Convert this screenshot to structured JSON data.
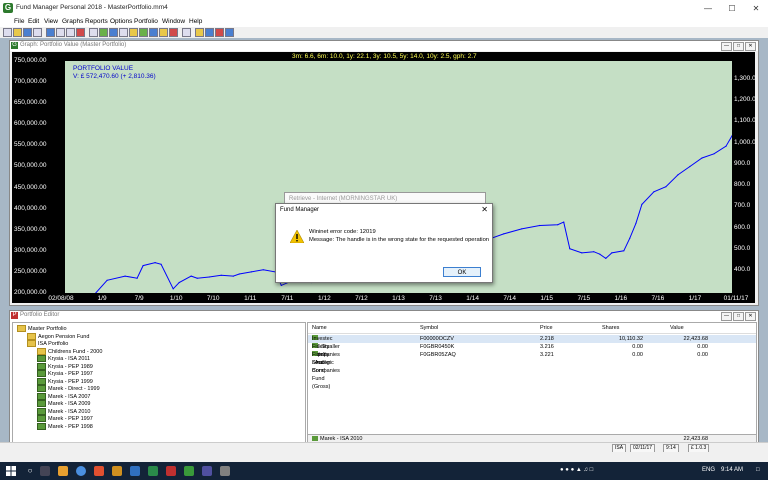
{
  "window": {
    "title": "Fund Manager Personal 2018 - MasterPortfolio.mm4",
    "app_icon_letter": "G"
  },
  "menu": [
    "File",
    "Edit",
    "View",
    "Graphs",
    "Reports",
    "Options",
    "Portfolio",
    "Window",
    "Help"
  ],
  "graph_window": {
    "title": "Graph: Portfolio Value (Master Portfolio)",
    "icon_letter": "G",
    "performance": "3m: 6.6,    6m: 10.0,    1y: 22.1,    3y: 10.5,    5y: 14.0,    10y: 2.5,    gph: 2.7",
    "label": "PORTFOLIO VALUE",
    "value": "V: £ 572,470.60 (+ 2,810.36)"
  },
  "chart_data": {
    "type": "line",
    "title": "Graph: Portfolio Value (Master Portfolio)",
    "xlabel": "",
    "ylabel": "",
    "ylim": [
      200000,
      750000
    ],
    "y_ticks": [
      "750,000.00",
      "700,000.00",
      "650,000.00",
      "600,000.00",
      "550,000.00",
      "500,000.00",
      "450,000.00",
      "400,000.00",
      "350,000.00",
      "300,000.00",
      "250,000.00",
      "200,000.00"
    ],
    "y2_ticks": [
      "1,300.0",
      "1,200.0",
      "1,100.0",
      "1,000.0",
      "900.0",
      "800.0",
      "700.0",
      "600.0",
      "500.0",
      "400.0"
    ],
    "x_ticks": [
      "02/08/08",
      "1/9",
      "7/9",
      "1/10",
      "7/10",
      "1/11",
      "7/11",
      "1/12",
      "7/12",
      "1/13",
      "7/13",
      "1/14",
      "7/14",
      "1/15",
      "7/15",
      "1/16",
      "7/16",
      "1/17",
      "01/11/17"
    ],
    "grid": false,
    "line_color": "#0000ff",
    "background": "#c5dfc5",
    "x": [
      "2008-08",
      "2008-12",
      "2009-01",
      "2009-03",
      "2009-06",
      "2009-08",
      "2009-09",
      "2009-11",
      "2009-12",
      "2010-02",
      "2010-03",
      "2010-05",
      "2010-06",
      "2010-08",
      "2010-10",
      "2010-12",
      "2011-01",
      "2011-03",
      "2011-05",
      "2011-07",
      "2011-08",
      "2011-10",
      "2011-12",
      "2012-01",
      "2014-05",
      "2014-06",
      "2014-09",
      "2014-12",
      "2015-03",
      "2015-06",
      "2015-07",
      "2015-08",
      "2015-10",
      "2015-12",
      "2016-01",
      "2016-02",
      "2016-03",
      "2016-05",
      "2016-06",
      "2016-07",
      "2016-08",
      "2016-10",
      "2016-12",
      "2017-02",
      "2017-04",
      "2017-06",
      "2017-08",
      "2017-10",
      "2017-11"
    ],
    "values": [
      195000,
      195000,
      198000,
      230000,
      240000,
      235000,
      265000,
      272000,
      268000,
      210000,
      225000,
      240000,
      235000,
      238000,
      242000,
      240000,
      245000,
      250000,
      255000,
      250000,
      218000,
      230000,
      235000,
      225000,
      318000,
      325000,
      340000,
      352000,
      360000,
      362000,
      368000,
      305000,
      295000,
      298000,
      292000,
      282000,
      295000,
      300000,
      330000,
      365000,
      410000,
      440000,
      452000,
      480000,
      500000,
      520000,
      530000,
      548000,
      572470
    ]
  },
  "retrieve_window": {
    "title": "Retrieve - Internet (MORNINGSTAR UK)"
  },
  "dialog": {
    "title": "Fund Manager",
    "close": "✕",
    "line1": "Wininet error code: 12019",
    "line2": "Message: The handle is in the wrong state for the requested operation",
    "ok": "OK"
  },
  "editor": {
    "title": "Portfolio Editor",
    "icon_letter": "P",
    "tree": [
      {
        "label": "Master Portfolio",
        "level": 0,
        "icon": "folder"
      },
      {
        "label": "Aegon Pension Fund",
        "level": 1,
        "icon": "folder"
      },
      {
        "label": "ISA Portfolio",
        "level": 1,
        "icon": "folder"
      },
      {
        "label": "Childrens Fund - 2000",
        "level": 2,
        "icon": "folder"
      },
      {
        "label": "Krysia - ISA 2011",
        "level": 2,
        "icon": "green"
      },
      {
        "label": "Krysia - PEP 1989",
        "level": 2,
        "icon": "green"
      },
      {
        "label": "Krysia - PEP 1997",
        "level": 2,
        "icon": "green"
      },
      {
        "label": "Krysia - PEP 1999",
        "level": 2,
        "icon": "green"
      },
      {
        "label": "Marek - Direct - 1999",
        "level": 2,
        "icon": "green"
      },
      {
        "label": "Marek - ISA 2007",
        "level": 2,
        "icon": "green"
      },
      {
        "label": "Marek - ISA 2009",
        "level": 2,
        "icon": "green"
      },
      {
        "label": "Marek - ISA 2010",
        "level": 2,
        "icon": "green"
      },
      {
        "label": "Marek - PEP 1997",
        "level": 2,
        "icon": "green"
      },
      {
        "label": "Marek - PEP 1998",
        "level": 2,
        "icon": "green"
      }
    ],
    "columns": {
      "name": "Name",
      "symbol": "Symbol",
      "price": "Price",
      "shares": "Shares",
      "value": "Value"
    },
    "rows": [
      {
        "name": "Investec UK Smaller Companies I Acc",
        "symbol": "F00000OCZV",
        "price": "2.218",
        "shares": "10,110.32",
        "value": "22,423.68"
      },
      {
        "name": "Fidelity Japan Smaller Companies",
        "symbol": "F0GBR0450K",
        "price": "3.216",
        "shares": "0.00",
        "value": "0.00"
      },
      {
        "name": "Fidelity Strategic Bond Fund (Gross)",
        "symbol": "F0GBR05ZAQ",
        "price": "3.221",
        "shares": "0.00",
        "value": "0.00"
      }
    ],
    "total": {
      "label": "Marek - ISA 2010",
      "value": "22,423.68"
    }
  },
  "statusbar": {
    "isa": "ISA",
    "date": "02/11/17",
    "time": "9:14",
    "code": "£ 1.0.3"
  },
  "taskbar": {
    "time": "9:14 AM",
    "lang": "ENG"
  }
}
